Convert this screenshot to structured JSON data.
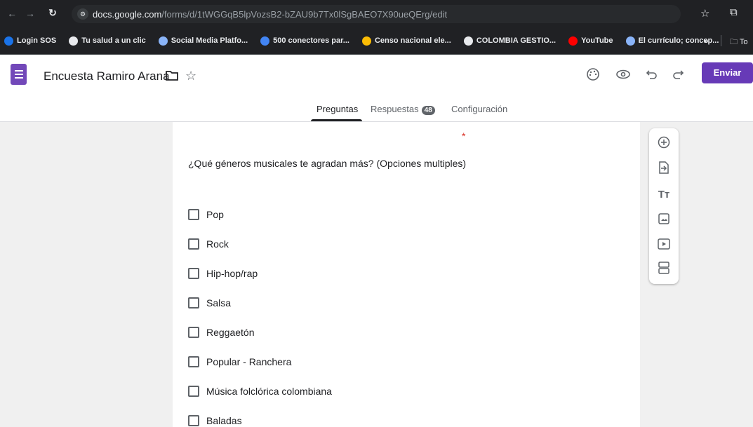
{
  "browser": {
    "url_domain": "docs.google.com",
    "url_path": "/forms/d/1tWGGqB5lpVozsB2-bZAU9b7Tx0lSgBAEO7X90ueQErg/edit",
    "bookmarks": [
      {
        "label": "Login SOS",
        "color": "#1a73e8"
      },
      {
        "label": "Tu salud a un clic",
        "color": "#e8eaed"
      },
      {
        "label": "Social Media Platfo...",
        "color": "#8ab4f8"
      },
      {
        "label": "500 conectores par...",
        "color": "#4285f4"
      },
      {
        "label": "Censo nacional ele...",
        "color": "#fbbc04"
      },
      {
        "label": "COLOMBIA GESTIO...",
        "color": "#e8eaed"
      },
      {
        "label": "YouTube",
        "color": "#ff0000"
      },
      {
        "label": "El currículo; concep...",
        "color": "#8ab4f8"
      }
    ],
    "bookmarks_more": "»",
    "bookmarks_folder": "To"
  },
  "form": {
    "title": "Encuesta Ramiro Arana",
    "send_label": "Enviar",
    "tabs": {
      "questions": "Preguntas",
      "responses": "Respuestas",
      "responses_count": "48",
      "settings": "Configuración"
    },
    "required_mark": "*",
    "question": "¿Qué géneros musicales te agradan más? (Opciones multiples)",
    "options": [
      "Pop",
      "Rock",
      "Hip-hop/rap",
      "Salsa",
      "Reggaetón",
      "Popular - Ranchera",
      "Música folclórica colombiana",
      "Baladas"
    ]
  },
  "colors": {
    "accent": "#673ab7",
    "required": "#d93025"
  }
}
